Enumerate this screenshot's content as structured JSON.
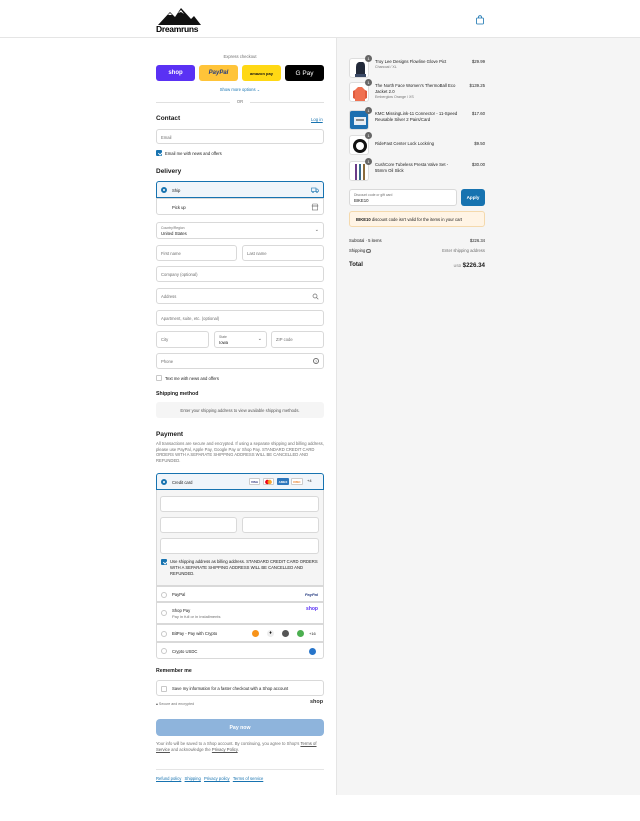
{
  "header": {
    "brand": "Dreamruns",
    "cart_icon": "shopping-bag-icon"
  },
  "express": {
    "title": "Express checkout",
    "buttons": [
      {
        "label": "shop",
        "color": "#5a31f4"
      },
      {
        "label": "PayPal",
        "color": "#ffc439"
      },
      {
        "label": "amazon pay",
        "color": "#ffd814"
      },
      {
        "label": "G Pay",
        "color": "#000000"
      }
    ],
    "show_more": "Show more options",
    "or": "OR"
  },
  "contact": {
    "title": "Contact",
    "login": "Log in",
    "email_placeholder": "Email",
    "news_label": "Email me with news and offers",
    "news_checked": true
  },
  "delivery": {
    "title": "Delivery",
    "options": [
      {
        "label": "Ship",
        "selected": true,
        "icon": "truck-icon"
      },
      {
        "label": "Pick up",
        "selected": false,
        "icon": "store-icon"
      }
    ],
    "country_label": "Country/Region",
    "country_value": "United States",
    "first_name": "First name",
    "last_name": "Last name",
    "company": "Company (optional)",
    "address": "Address",
    "apartment": "Apartment, suite, etc. (optional)",
    "city": "City",
    "state_label": "State",
    "state_value": "Iowa",
    "zip": "ZIP code",
    "phone": "Phone",
    "text_offers": "Text me with news and offers"
  },
  "shipping_method": {
    "title": "Shipping method",
    "message": "Enter your shipping address to view available shipping methods."
  },
  "payment": {
    "title": "Payment",
    "description": "All transactions are secure and encrypted. If using a separate shipping and billing address, please use PayPal, Apple Pay, Google Pay or Shop Pay. STANDARD CREDIT CARD ORDERS WITH A SEPARATE SHIPPING ADDRESS WILL BE CANCELLED AND REFUNDED.",
    "credit_card": "Credit card",
    "card_more": "+4",
    "card_brands": [
      "VISA",
      "MC",
      "AMEX",
      "DISC"
    ],
    "billing_same": "Use shipping address as billing address. STANDARD CREDIT CARD ORDERS WITH A SEPARATE SHIPPING ADDRESS WILL BE CANCELLED AND REFUNDED.",
    "paypal": "PayPal",
    "paypal_logo": "PayPal",
    "shoppay": "Shop Pay",
    "shoppay_sub": "Pay in full or in installments",
    "shoppay_logo": "shop",
    "bitpay": "BitPay - Pay with Crypto",
    "bitpay_more": "+16",
    "crypto": "Crypto USDC"
  },
  "remember": {
    "title": "Remember me",
    "save_label": "Save my information for a faster checkout with a Shop account",
    "secure": "Secure and encrypted",
    "shop_logo": "shop"
  },
  "pay_now": "Pay now",
  "legal": {
    "text1": "Your info will be saved to a Shop account. By continuing, you agree to Shop's",
    "tos": "Terms of Service",
    "text2": "and acknowledge the",
    "privacy": "Privacy Policy",
    "end": "."
  },
  "footer": [
    "Refund policy",
    "Shipping",
    "Privacy policy",
    "Terms of service"
  ],
  "cart": {
    "items": [
      {
        "qty": "1",
        "name": "Troy Lee Designs Flowline Glove Pict",
        "variant": "Charcoal / XL",
        "price": "$29.99",
        "thumb_color": "#222a3a"
      },
      {
        "qty": "1",
        "name": "The North Face Women's ThermoBall Eco Jacket 2.0",
        "variant": "Emberglow Orange / XS",
        "price": "$139.25",
        "thumb_color": "#f07050"
      },
      {
        "qty": "1",
        "name": "KMC MissingLink-11 Connector - 11-Speed Reusable Silver 2 Pairs/Card",
        "variant": "",
        "price": "$17.60",
        "thumb_color": "#1d6fb0"
      },
      {
        "qty": "1",
        "name": "RideFast Center Lock Lockring",
        "variant": "",
        "price": "$9.50",
        "thumb_color": "#111111"
      },
      {
        "qty": "1",
        "name": "CushCore Tubeless Presta Valve Set - 55mm Oil Slick",
        "variant": "",
        "price": "$30.00",
        "thumb_color": "#6b3c8a"
      }
    ],
    "discount_label": "Discount code or gift card",
    "discount_value": "BIKE10",
    "apply": "Apply",
    "error_code": "BIKE10",
    "error_text": "discount code isn't valid for the items in your cart",
    "subtotal_label": "Subtotal · 5 items",
    "subtotal": "$226.34",
    "shipping_label": "Shipping",
    "shipping_value": "Enter shipping address",
    "total_label": "Total",
    "currency": "USD",
    "total": "$226.34"
  }
}
